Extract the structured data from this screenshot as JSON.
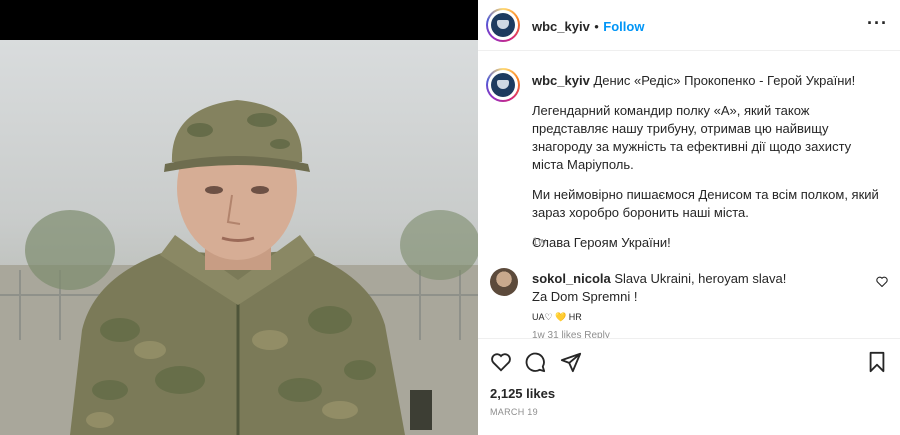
{
  "post": {
    "username": "wbc_kyiv",
    "dot": "•",
    "follow_label": "Follow",
    "caption_title": "Денис «Редіс» Прокопенко - Герой України!",
    "caption_p1": "Легендарний командир полку «А», який також представляє нашу трибуну, отримав цю найвищу знагороду за мужність та ефективні дії щодо захисту міста Маріуполь.",
    "caption_p2": "Ми неймовірно пишаємося Денисом та всім полком, який зараз хоробро боронить наші міста.",
    "caption_p3": "Слава Героям України!",
    "time_ago": "1w",
    "likes": "2,125 likes",
    "date": "MARCH 19"
  },
  "comment": {
    "username": "sokol_nicola",
    "text1": "Slava Ukraini, heroyam slava!",
    "text2": "Za Dom Spremni !",
    "meta": "UA♡ 💛 HR",
    "faded_meta": "1w  31 likes  Reply"
  },
  "colors": {
    "accent": "#0095f6",
    "muted": "#8e8e8e",
    "text": "#262626"
  },
  "icons": [
    "more-icon",
    "like-icon",
    "comment-icon",
    "share-icon",
    "save-icon",
    "comment-like-icon"
  ]
}
